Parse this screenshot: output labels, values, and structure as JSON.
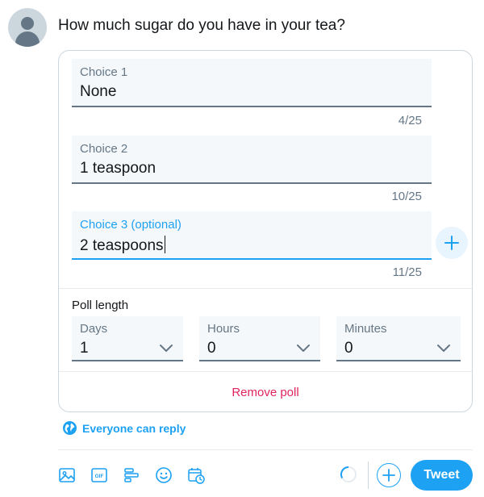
{
  "compose": {
    "question": "How much sugar do you have in your tea?"
  },
  "poll": {
    "choices": [
      {
        "label": "Choice 1",
        "value": "None",
        "counter": "4/25"
      },
      {
        "label": "Choice 2",
        "value": "1 teaspoon",
        "counter": "10/25"
      },
      {
        "label": "Choice 3 (optional)",
        "value": "2 teaspoons",
        "counter": "11/25"
      }
    ],
    "length": {
      "title": "Poll length",
      "days_label": "Days",
      "days_value": "1",
      "hours_label": "Hours",
      "hours_value": "0",
      "minutes_label": "Minutes",
      "minutes_value": "0"
    },
    "remove_label": "Remove poll"
  },
  "reply": {
    "label": "Everyone can reply"
  },
  "toolbar": {
    "tweet_label": "Tweet",
    "gif_text": "GIF",
    "icons": [
      "image-icon",
      "gif-icon",
      "poll-icon",
      "emoji-icon",
      "schedule-icon"
    ]
  },
  "colors": {
    "accent": "#1da1f2",
    "danger": "#e0245e",
    "secondary_text": "#657786",
    "field_bg": "#f5f8fa"
  }
}
